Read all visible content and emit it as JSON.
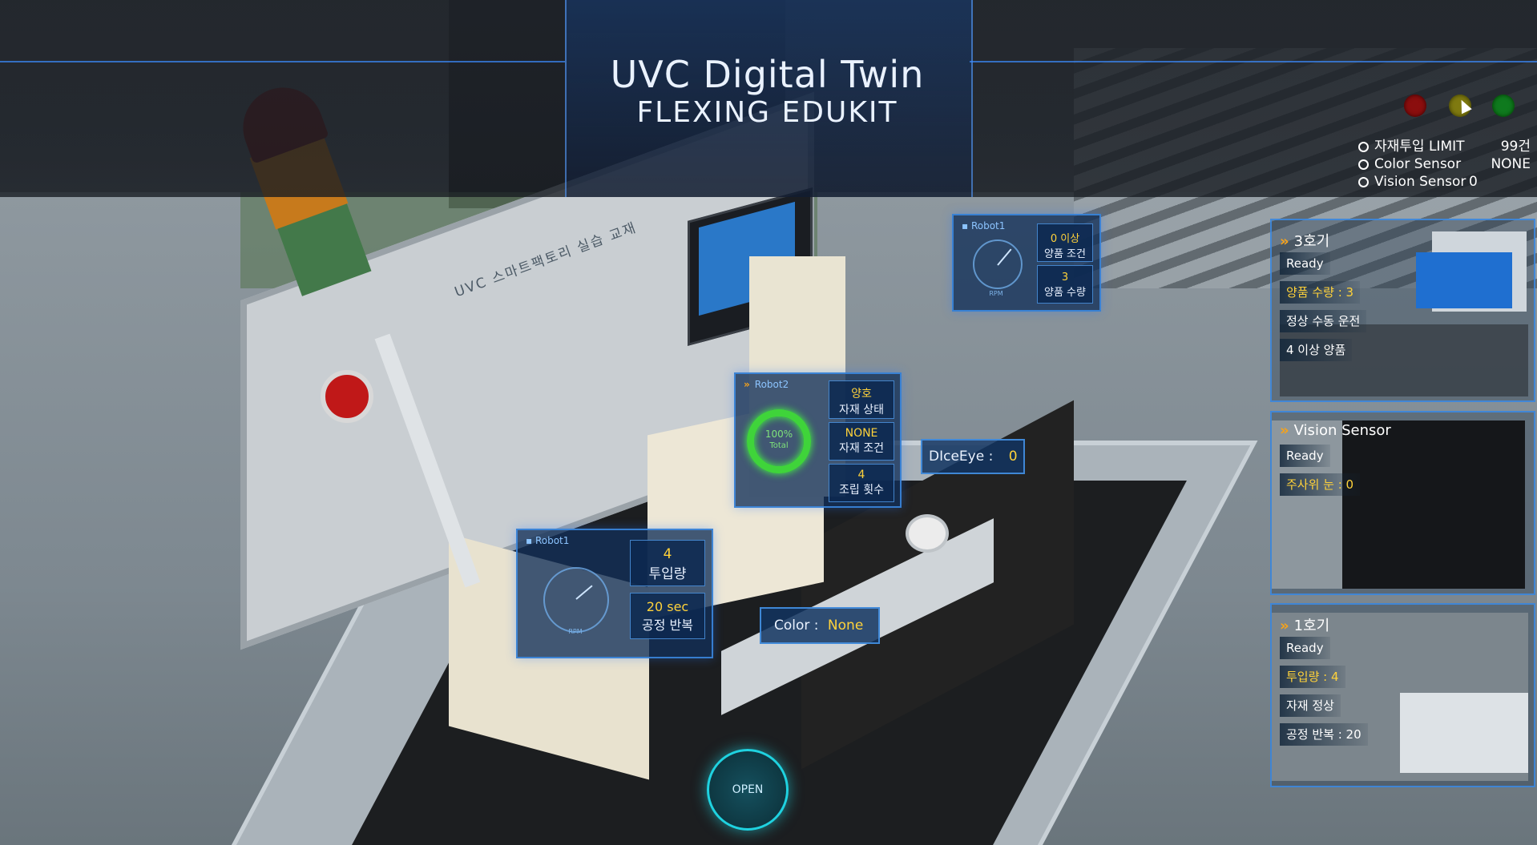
{
  "header": {
    "title": "UVC Digital Twin",
    "subtitle": "FLEXING EDUKIT"
  },
  "lamps": {
    "red": "#8b0e0e",
    "yellow": "#7f7a10",
    "green": "#0f7a1e"
  },
  "limits": [
    {
      "label": "자재투입 LIMIT",
      "value": "99건"
    },
    {
      "label": "Color Sensor",
      "value": "NONE"
    },
    {
      "label": "Vision Sensor",
      "value": "0"
    }
  ],
  "scene": {
    "board_label": "UVC 스마트팩토리 실습 교재"
  },
  "robot1_top": {
    "name": "Robot1",
    "box1_value": "0 이상",
    "box1_label": "양품 조건",
    "box2_value": "3",
    "box2_label": "양품 수량",
    "gauge_unit": "RPM"
  },
  "robot2": {
    "name": "Robot2",
    "ring_percent": "100%",
    "ring_label": "Total",
    "box1_value": "양호",
    "box1_label": "자재 상태",
    "box2_value": "NONE",
    "box2_label": "자재 조건",
    "box3_value": "4",
    "box3_label": "조립 횟수"
  },
  "robot1_bottom": {
    "name": "Robot1",
    "box1_value": "4",
    "box1_label": "투입량",
    "box2_value": "20 sec",
    "box2_label": "공정 반복",
    "gauge_unit": "RPM"
  },
  "tags": {
    "diceeye_label": "DIceEye :",
    "diceeye_value": "0",
    "color_label": "Color :",
    "color_value": "None"
  },
  "open_button": "OPEN",
  "cards": [
    {
      "title": "3호기",
      "rows": [
        {
          "text": "Ready",
          "highlight": false
        },
        {
          "text": "양품 수량 : 3",
          "highlight": true
        },
        {
          "text": "정상 수동 운전",
          "highlight": false
        },
        {
          "text": "4 이상 양품",
          "highlight": false
        }
      ]
    },
    {
      "title": "Vision Sensor",
      "rows": [
        {
          "text": "Ready",
          "highlight": false
        },
        {
          "text": "주사위 눈 : 0",
          "highlight": true
        }
      ]
    },
    {
      "title": "1호기",
      "rows": [
        {
          "text": "Ready",
          "highlight": false
        },
        {
          "text": "투입량 : 4",
          "highlight": true
        },
        {
          "text": "자재 정상",
          "highlight": false
        },
        {
          "text": "공정 반복 : 20",
          "highlight": false
        }
      ]
    }
  ],
  "colors": {
    "accent_blue": "#3c8ce6",
    "highlight_yellow": "#ffd23a",
    "chevron_orange": "#f5a21b",
    "ring_green": "#3fd43a",
    "open_cyan": "#1fd2e0"
  }
}
